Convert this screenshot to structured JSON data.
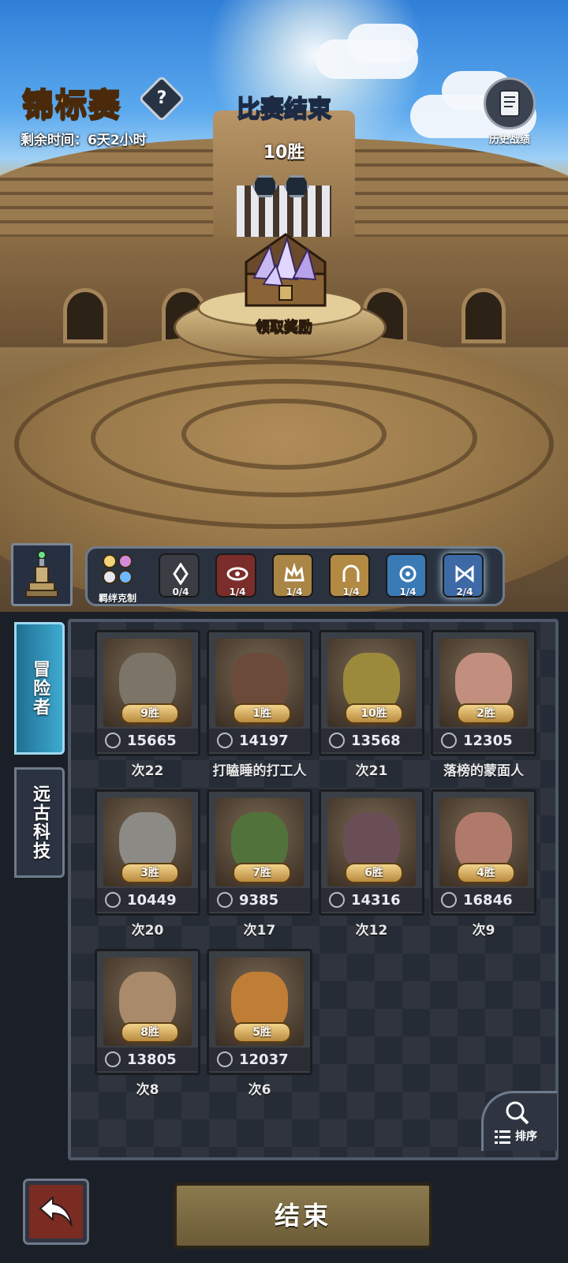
{
  "header": {
    "title": "锦标赛",
    "help_glyph": "?",
    "time_remaining": "剩余时间：6天2小时",
    "match_status": "比赛结束",
    "wins": "10胜",
    "history_label": "历史战绩"
  },
  "chest": {
    "claim_label": "领取奖励"
  },
  "synergy": {
    "first_label": "羁绊克制",
    "tiles": [
      {
        "count": "0/4",
        "color": "#3a3d44"
      },
      {
        "count": "1/4",
        "color": "#7a2d2a"
      },
      {
        "count": "1/4",
        "color": "#a98546"
      },
      {
        "count": "1/4",
        "color": "#b38a44"
      },
      {
        "count": "1/4",
        "color": "#3a7ab5"
      },
      {
        "count": "2/4",
        "color": "#3d6aa6"
      }
    ]
  },
  "tabs": [
    {
      "label": "冒险者"
    },
    {
      "label": "远古科技"
    }
  ],
  "cards": [
    {
      "wins": "9胜",
      "power": "15665",
      "name": "次22",
      "tint": "#7d7468"
    },
    {
      "wins": "1胜",
      "power": "14197",
      "name": "打瞌睡的打工人",
      "tint": "#6b4a3a"
    },
    {
      "wins": "10胜",
      "power": "13568",
      "name": "次21",
      "tint": "#9c8a3c"
    },
    {
      "wins": "2胜",
      "power": "12305",
      "name": "落榜的蒙面人",
      "tint": "#c28f7e"
    },
    {
      "wins": "3胜",
      "power": "10449",
      "name": "次20",
      "tint": "#8c8a85"
    },
    {
      "wins": "7胜",
      "power": "9385",
      "name": "次17",
      "tint": "#52723c"
    },
    {
      "wins": "6胜",
      "power": "14316",
      "name": "次12",
      "tint": "#6a4e55"
    },
    {
      "wins": "4胜",
      "power": "16846",
      "name": "次9",
      "tint": "#b07a6a"
    },
    {
      "wins": "8胜",
      "power": "13805",
      "name": "次8",
      "tint": "#a98a6a"
    },
    {
      "wins": "5胜",
      "power": "12037",
      "name": "次6",
      "tint": "#c07d36"
    }
  ],
  "sort_label": "排序",
  "end_button": "结束"
}
